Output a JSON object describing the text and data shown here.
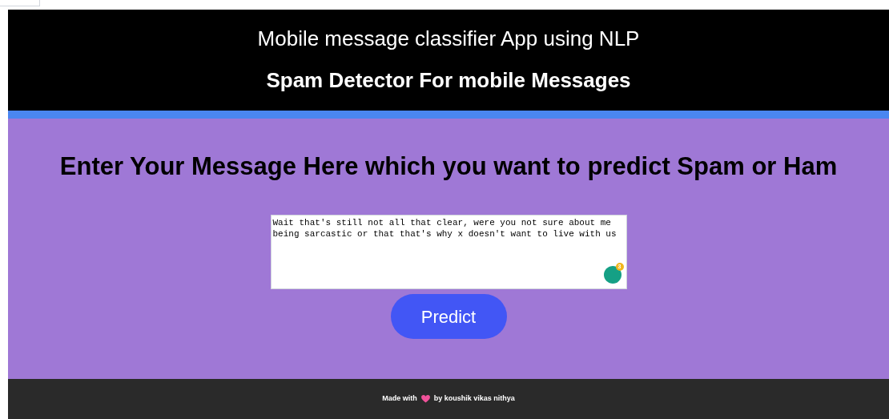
{
  "header": {
    "title": "Mobile message classifier App using NLP",
    "subtitle": "Spam Detector For mobile Messages"
  },
  "main": {
    "heading": "Enter Your Message Here which you want to predict Spam or Ham",
    "message": {
      "value": "Wait that's still not all that clear, were you not sure about me being sarcastic or that that's why x doesn't want to live with us"
    },
    "grammar_badge": "3",
    "button": "Predict"
  },
  "footer": {
    "before": "Made with",
    "after": "by koushik vikas nithya"
  }
}
